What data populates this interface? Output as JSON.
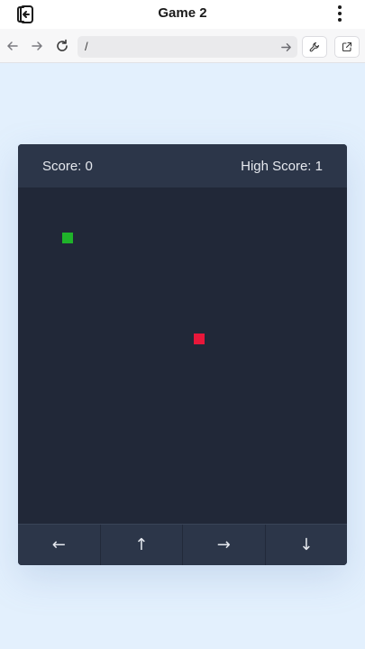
{
  "app": {
    "title": "Game 2"
  },
  "browser": {
    "url": "/"
  },
  "game": {
    "score_text": "Score: 0",
    "high_score_text": "High Score: 1",
    "score": 0,
    "high_score": 1,
    "snake_color": "#1fb32a",
    "food_color": "#e8173a",
    "board_color": "#212838"
  },
  "controls": {
    "left": "←",
    "up": "↑",
    "right": "→",
    "down": "↓"
  },
  "icons": {
    "exit": "exit-icon",
    "menu": "more-vertical-icon",
    "back": "arrow-left-icon",
    "forward": "arrow-right-icon",
    "reload": "reload-icon",
    "go": "arrow-right-icon",
    "devtools": "wrench-icon",
    "open_external": "external-link-icon"
  }
}
